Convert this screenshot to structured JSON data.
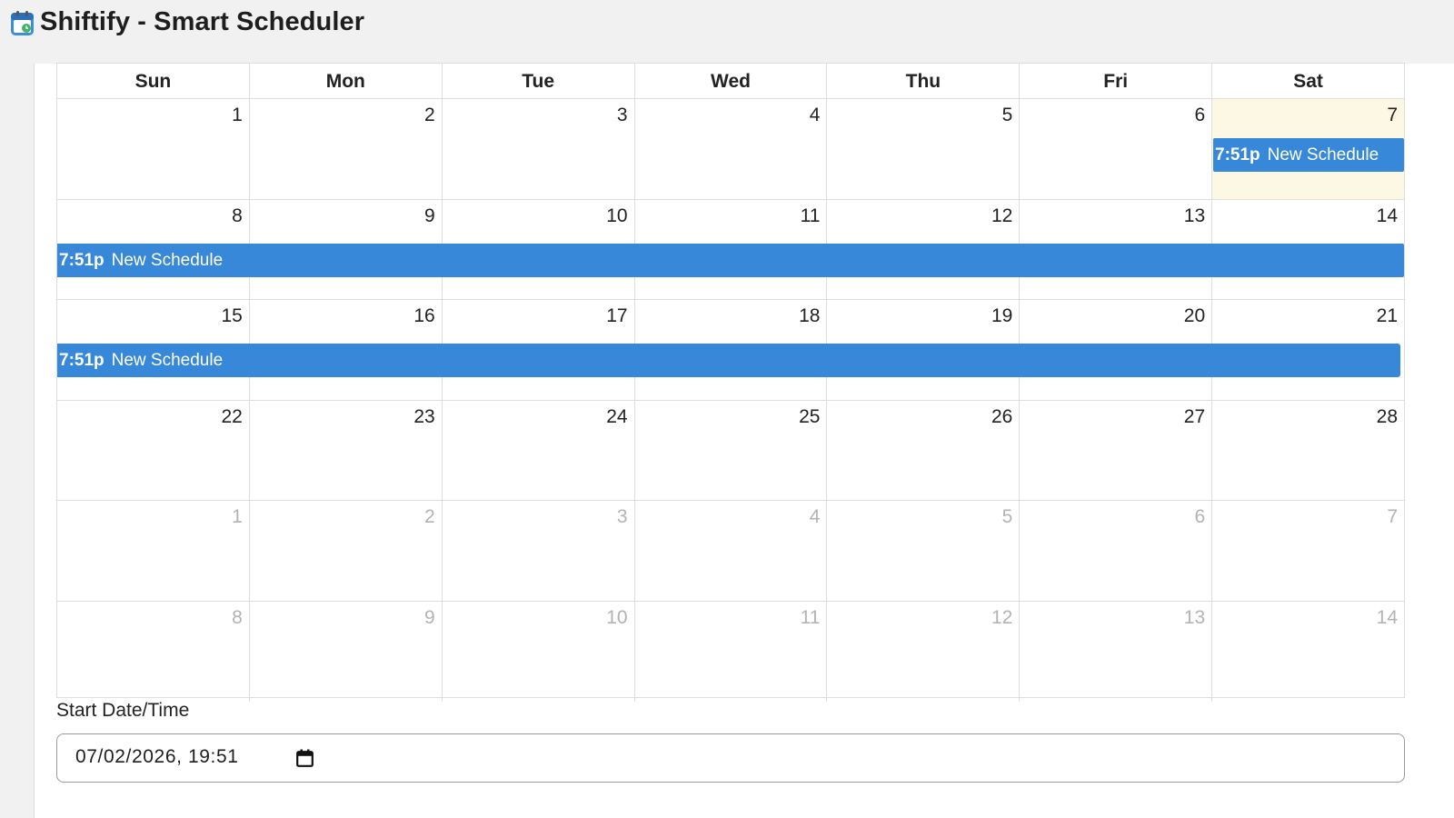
{
  "app": {
    "title": "Shiftify - Smart Scheduler",
    "icon": "calendar-app-icon"
  },
  "colors": {
    "event": "#3788d8",
    "today": "#fcf8e3",
    "other_month_text": "#b3b3b3"
  },
  "calendar": {
    "days_of_week": [
      "Sun",
      "Mon",
      "Tue",
      "Wed",
      "Thu",
      "Fri",
      "Sat"
    ],
    "weeks": [
      [
        "1",
        "2",
        "3",
        "4",
        "5",
        "6",
        "7"
      ],
      [
        "8",
        "9",
        "10",
        "11",
        "12",
        "13",
        "14"
      ],
      [
        "15",
        "16",
        "17",
        "18",
        "19",
        "20",
        "21"
      ],
      [
        "22",
        "23",
        "24",
        "25",
        "26",
        "27",
        "28"
      ],
      [
        "1",
        "2",
        "3",
        "4",
        "5",
        "6",
        "7"
      ],
      [
        "8",
        "9",
        "10",
        "11",
        "12",
        "13",
        "14"
      ]
    ],
    "events": [
      {
        "time": "7:51p",
        "title": "New Schedule"
      },
      {
        "time": "7:51p",
        "title": "New Schedule"
      },
      {
        "time": "7:51p",
        "title": "New Schedule"
      }
    ]
  },
  "form": {
    "start_label": "Start Date/Time",
    "start_value": "07/02/2026, 19:51",
    "picker_icon": "calendar-icon"
  }
}
